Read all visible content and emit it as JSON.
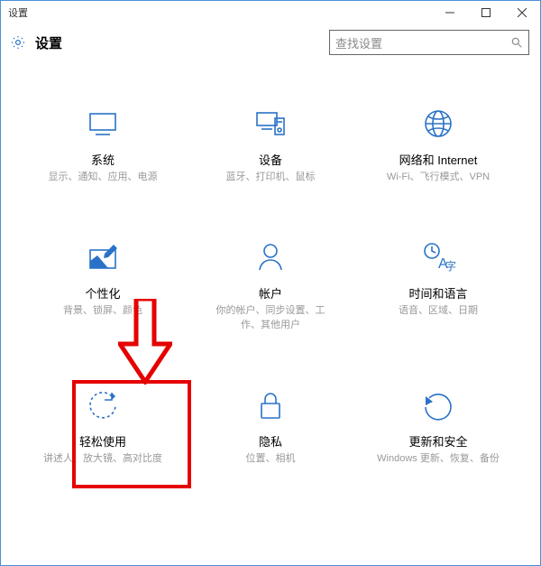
{
  "window": {
    "title": "设置"
  },
  "header": {
    "title": "设置"
  },
  "search": {
    "placeholder": "查找设置"
  },
  "tiles": {
    "system": {
      "title": "系统",
      "desc": "显示、通知、应用、电源"
    },
    "devices": {
      "title": "设备",
      "desc": "蓝牙、打印机、鼠标"
    },
    "network": {
      "title": "网络和 Internet",
      "desc": "Wi-Fi、飞行模式、VPN"
    },
    "personal": {
      "title": "个性化",
      "desc": "背景、锁屏、颜色"
    },
    "accounts": {
      "title": "帐户",
      "desc": "你的帐户、同步设置、工作、其他用户"
    },
    "time": {
      "title": "时间和语言",
      "desc": "语音、区域、日期"
    },
    "ease": {
      "title": "轻松使用",
      "desc": "讲述人、放大镜、高对比度"
    },
    "privacy": {
      "title": "隐私",
      "desc": "位置、相机"
    },
    "update": {
      "title": "更新和安全",
      "desc": "Windows 更新、恢复、备份"
    }
  },
  "colors": {
    "accent": "#2972c7",
    "annotation": "#e60000"
  }
}
